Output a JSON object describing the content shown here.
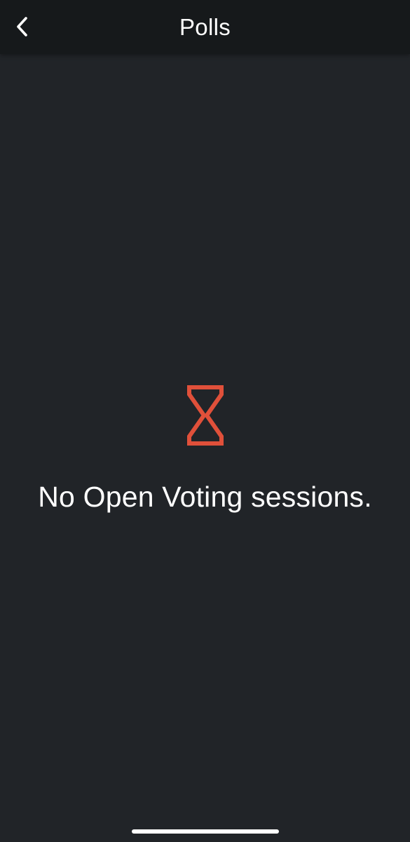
{
  "header": {
    "title": "Polls",
    "back_icon": "chevron-left-icon"
  },
  "empty_state": {
    "icon": "hourglass-icon",
    "icon_color": "#e0503a",
    "message": "No Open Voting sessions."
  },
  "colors": {
    "background": "#212428",
    "nav_background": "#16191b",
    "text": "#ffffff"
  }
}
